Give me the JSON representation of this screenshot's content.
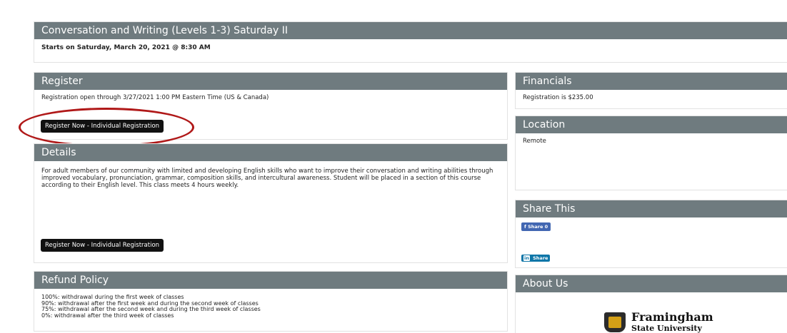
{
  "course": {
    "title": "Conversation and Writing (Levels 1-3) Saturday II",
    "start": "Starts on Saturday, March 20, 2021 @ 8:30 AM"
  },
  "register": {
    "heading": "Register",
    "open_text": "Registration open through 3/27/2021 1:00 PM Eastern Time (US & Canada)",
    "button_label": "Register Now - Individual Registration"
  },
  "details": {
    "heading": "Details",
    "body": "For adult members of our community with limited and developing English skills who want to improve their conversation and writing abilities through improved vocabulary, pronunciation, grammar, composition skills, and intercultural awareness. Student will be placed in a section of this course according to their English level. This class meets 4 hours weekly.",
    "button_label": "Register Now - Individual Registration"
  },
  "refund": {
    "heading": "Refund Policy",
    "lines": [
      "100%: withdrawal during the first week of classes",
      "90%: withdrawal after the first week and during the second week of classes",
      "75%: withdrawal after the second week and during the third week of classes",
      "0%: withdrawal after the third week of classes"
    ]
  },
  "financials": {
    "heading": "Financials",
    "text": "Registration is $235.00"
  },
  "location": {
    "heading": "Location",
    "text": "Remote"
  },
  "share": {
    "heading": "Share This",
    "facebook_label": "Share 0",
    "facebook_icon": "f",
    "linkedin_label": "Share",
    "linkedin_icon": "in"
  },
  "about": {
    "heading": "About Us",
    "logo_line1": "Framingham",
    "logo_line2": "State University"
  },
  "colors": {
    "panel_header": "#6f7b7f",
    "button": "#111111",
    "highlight": "#b01818",
    "facebook": "#4267b2",
    "linkedin": "#0e76a8"
  }
}
